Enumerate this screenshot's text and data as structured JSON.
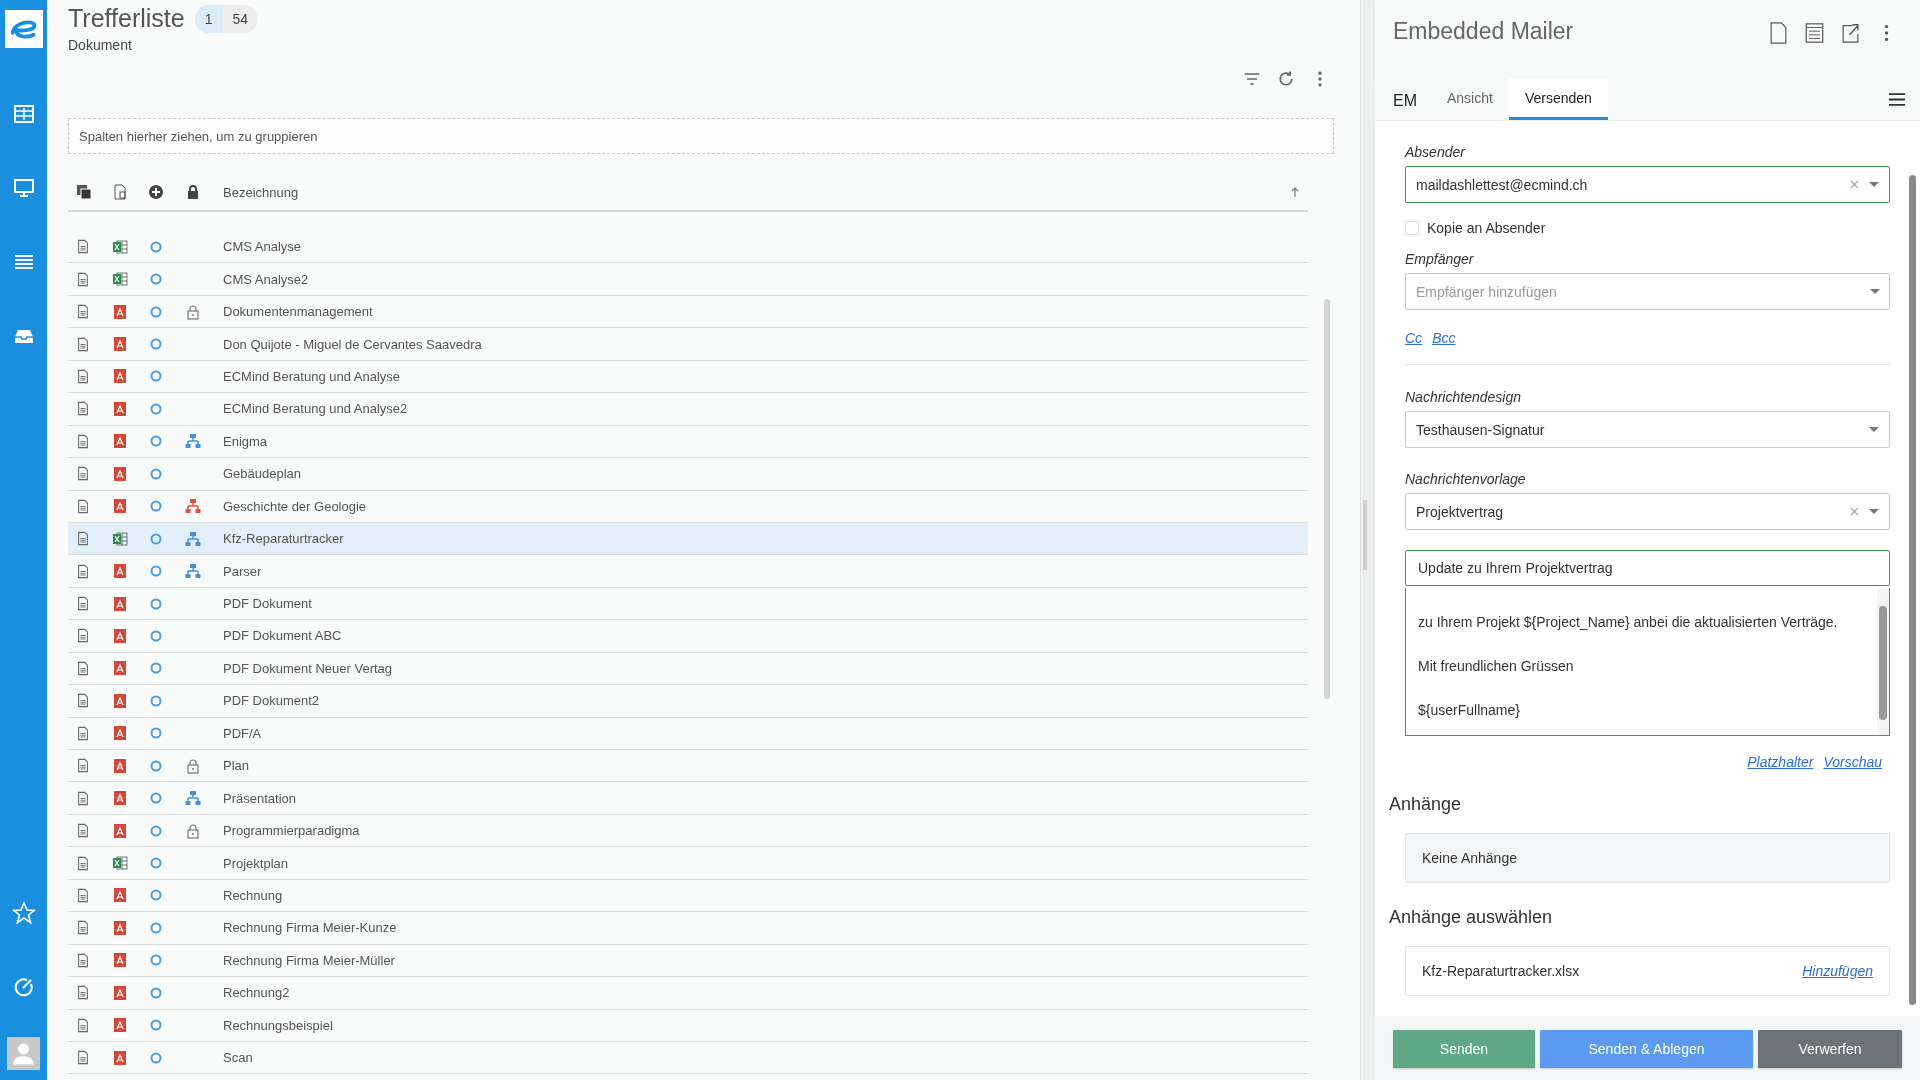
{
  "header": {
    "title": "Trefferliste",
    "counts": [
      {
        "value": "1",
        "selected": true
      },
      {
        "value": "54",
        "selected": false
      }
    ],
    "subtitle": "Dokument"
  },
  "group_hint": "Spalten hierher ziehen, um zu gruppieren",
  "table": {
    "column_header": "Bezeichnung",
    "rows": [
      {
        "name": "CMS Analyse",
        "kind": "excel",
        "locked": false,
        "workflow": false,
        "selected": false
      },
      {
        "name": "CMS Analyse2",
        "kind": "excel",
        "locked": false,
        "workflow": false,
        "selected": false
      },
      {
        "name": "Dokumentenmanagement",
        "kind": "pdf",
        "locked": true,
        "workflow": false,
        "selected": false
      },
      {
        "name": "Don Quijote - Miguel de Cervantes Saavedra",
        "kind": "pdf",
        "locked": false,
        "workflow": false,
        "selected": false
      },
      {
        "name": "ECMind Beratung und Analyse",
        "kind": "pdf",
        "locked": false,
        "workflow": false,
        "selected": false
      },
      {
        "name": "ECMind Beratung und Analyse2",
        "kind": "pdf",
        "locked": false,
        "workflow": false,
        "selected": false
      },
      {
        "name": "Enigma",
        "kind": "pdf",
        "locked": false,
        "workflow": true,
        "color": "#4a90d9",
        "selected": false
      },
      {
        "name": "Gebäudeplan",
        "kind": "pdf",
        "locked": false,
        "workflow": false,
        "selected": false
      },
      {
        "name": "Geschichte der Geologie",
        "kind": "pdf",
        "locked": false,
        "workflow": true,
        "color": "#d9533f",
        "selected": false
      },
      {
        "name": "Kfz-Reparaturtracker",
        "kind": "excel",
        "locked": false,
        "workflow": true,
        "color": "#4a90d9",
        "selected": true
      },
      {
        "name": "Parser",
        "kind": "pdf",
        "locked": false,
        "workflow": true,
        "color": "#4a90d9",
        "selected": false
      },
      {
        "name": "PDF Dokument",
        "kind": "pdf",
        "locked": false,
        "workflow": false,
        "selected": false
      },
      {
        "name": "PDF Dokument ABC",
        "kind": "pdf",
        "locked": false,
        "workflow": false,
        "selected": false
      },
      {
        "name": "PDF Dokument Neuer Vertag",
        "kind": "pdf",
        "locked": false,
        "workflow": false,
        "selected": false
      },
      {
        "name": "PDF Dokument2",
        "kind": "pdf",
        "locked": false,
        "workflow": false,
        "selected": false
      },
      {
        "name": "PDF/A",
        "kind": "pdf",
        "locked": false,
        "workflow": false,
        "selected": false
      },
      {
        "name": "Plan",
        "kind": "pdf",
        "locked": true,
        "workflow": false,
        "selected": false
      },
      {
        "name": "Präsentation",
        "kind": "pdf",
        "locked": false,
        "workflow": true,
        "color": "#4a90d9",
        "selected": false
      },
      {
        "name": "Programmierparadigma",
        "kind": "pdf",
        "locked": true,
        "workflow": false,
        "selected": false
      },
      {
        "name": "Projektplan",
        "kind": "excel",
        "locked": false,
        "workflow": false,
        "selected": false
      },
      {
        "name": "Rechnung",
        "kind": "pdf",
        "locked": false,
        "workflow": false,
        "selected": false
      },
      {
        "name": "Rechnung Firma Meier-Kunze",
        "kind": "pdf",
        "locked": false,
        "workflow": false,
        "selected": false
      },
      {
        "name": "Rechnung Firma Meier-Müller",
        "kind": "pdf",
        "locked": false,
        "workflow": false,
        "selected": false
      },
      {
        "name": "Rechnung2",
        "kind": "pdf",
        "locked": false,
        "workflow": false,
        "selected": false
      },
      {
        "name": "Rechnungsbeispiel",
        "kind": "pdf",
        "locked": false,
        "workflow": false,
        "selected": false
      },
      {
        "name": "Scan",
        "kind": "pdf",
        "locked": false,
        "workflow": false,
        "selected": false
      }
    ]
  },
  "mailer": {
    "title": "Embedded Mailer",
    "app_label": "EM",
    "tabs": [
      {
        "label": "Ansicht",
        "selected": false
      },
      {
        "label": "Versenden",
        "selected": true
      }
    ],
    "sender": {
      "label": "Absender",
      "value": "maildashlettest@ecmind.ch",
      "clearable": true
    },
    "copy_to_sender": {
      "label": "Kopie an Absender",
      "checked": false
    },
    "recipients": {
      "label": "Empfänger",
      "placeholder": "Empfänger hinzufügen"
    },
    "copy_links": [
      "Cc",
      "Bcc"
    ],
    "design": {
      "label": "Nachrichtendesign",
      "value": "Testhausen-Signatur",
      "clearable": false
    },
    "template": {
      "label": "Nachrichtenvorlage",
      "value": "Projektvertrag",
      "clearable": true
    },
    "subject": "Update zu Ihrem Projektvertrag",
    "body_lines": [
      "zu Ihrem Projekt ${Project_Name} anbei die aktualisierten Verträge.",
      "Mit freundlichen Grüssen",
      "${userFullname}"
    ],
    "editor_links": [
      "Platzhalter",
      "Vorschau"
    ],
    "attachments": {
      "heading": "Anhänge",
      "empty_text": "Keine Anhänge"
    },
    "select_attachments": {
      "heading": "Anhänge auswählen",
      "items": [
        {
          "name": "Kfz-Reparaturtracker.xlsx",
          "action": "Hinzufügen"
        }
      ]
    },
    "buttons": [
      {
        "label": "Senden",
        "kind": "success"
      },
      {
        "label": "Senden & Ablegen",
        "kind": "primary"
      },
      {
        "label": "Verwerfen",
        "kind": "secondary"
      }
    ]
  }
}
